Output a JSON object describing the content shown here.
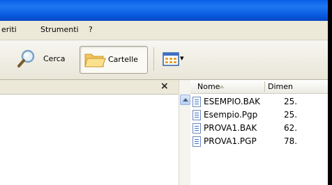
{
  "menubar": {
    "items": [
      "eriti",
      "Strumenti",
      "?"
    ]
  },
  "toolbar": {
    "search_label": "Cerca",
    "folders_label": "Cartelle",
    "views_arrow": "▾"
  },
  "folder_pane": {
    "close_glyph": "×"
  },
  "file_list": {
    "columns": [
      "Nome",
      "Dimen"
    ],
    "files": [
      {
        "name": "ESEMPIO.BAK",
        "size": "25."
      },
      {
        "name": "Esempio.Pgp",
        "size": "25."
      },
      {
        "name": "PROVA1.BAK",
        "size": "62."
      },
      {
        "name": "PROVA1.PGP",
        "size": "78."
      }
    ]
  },
  "colors": {
    "titlebar": "#0a5fe6",
    "chrome": "#ece9d8",
    "accent": "#3d6fc4"
  },
  "icons": {
    "search": "magnifier-icon",
    "folders": "folder-icon",
    "views": "view-grid-icon",
    "file": "text-file-icon"
  }
}
